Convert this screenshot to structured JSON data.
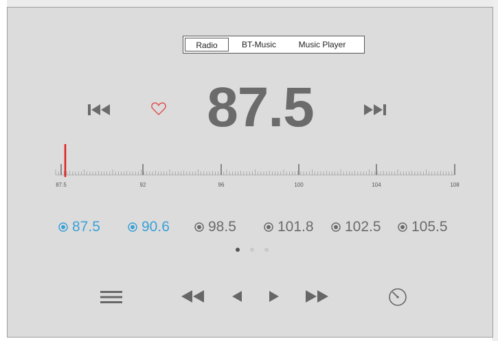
{
  "tabs": [
    {
      "label": "Radio",
      "active": true
    },
    {
      "label": "BT-Music",
      "active": false
    },
    {
      "label": "Music Player",
      "active": false
    }
  ],
  "frequency": "87.5",
  "icons": {
    "previous": "skip-previous-icon",
    "favorite": "heart-icon",
    "next": "skip-next-icon",
    "menu": "menu-icon",
    "rewind": "rewind-icon",
    "step_back": "step-back-icon",
    "play": "play-icon",
    "fast_forward": "fast-forward-icon",
    "gauge": "gauge-icon"
  },
  "colors": {
    "accent": "#3aa0d8",
    "needle": "#e02020",
    "heart": "#e05050",
    "text": "#6a6a6a"
  },
  "tuner": {
    "min": 87.5,
    "max": 108,
    "current": 87.5,
    "labels": [
      "87.5",
      "92",
      "96",
      "100",
      "104",
      "108"
    ]
  },
  "presets": [
    {
      "label": "87.5",
      "selected": true
    },
    {
      "label": "90.6",
      "selected": true
    },
    {
      "label": "98.5",
      "selected": false
    },
    {
      "label": "101.8",
      "selected": false
    },
    {
      "label": "102.5",
      "selected": false
    },
    {
      "label": "105.5",
      "selected": false
    }
  ],
  "pages": {
    "count": 3,
    "active": 0
  }
}
